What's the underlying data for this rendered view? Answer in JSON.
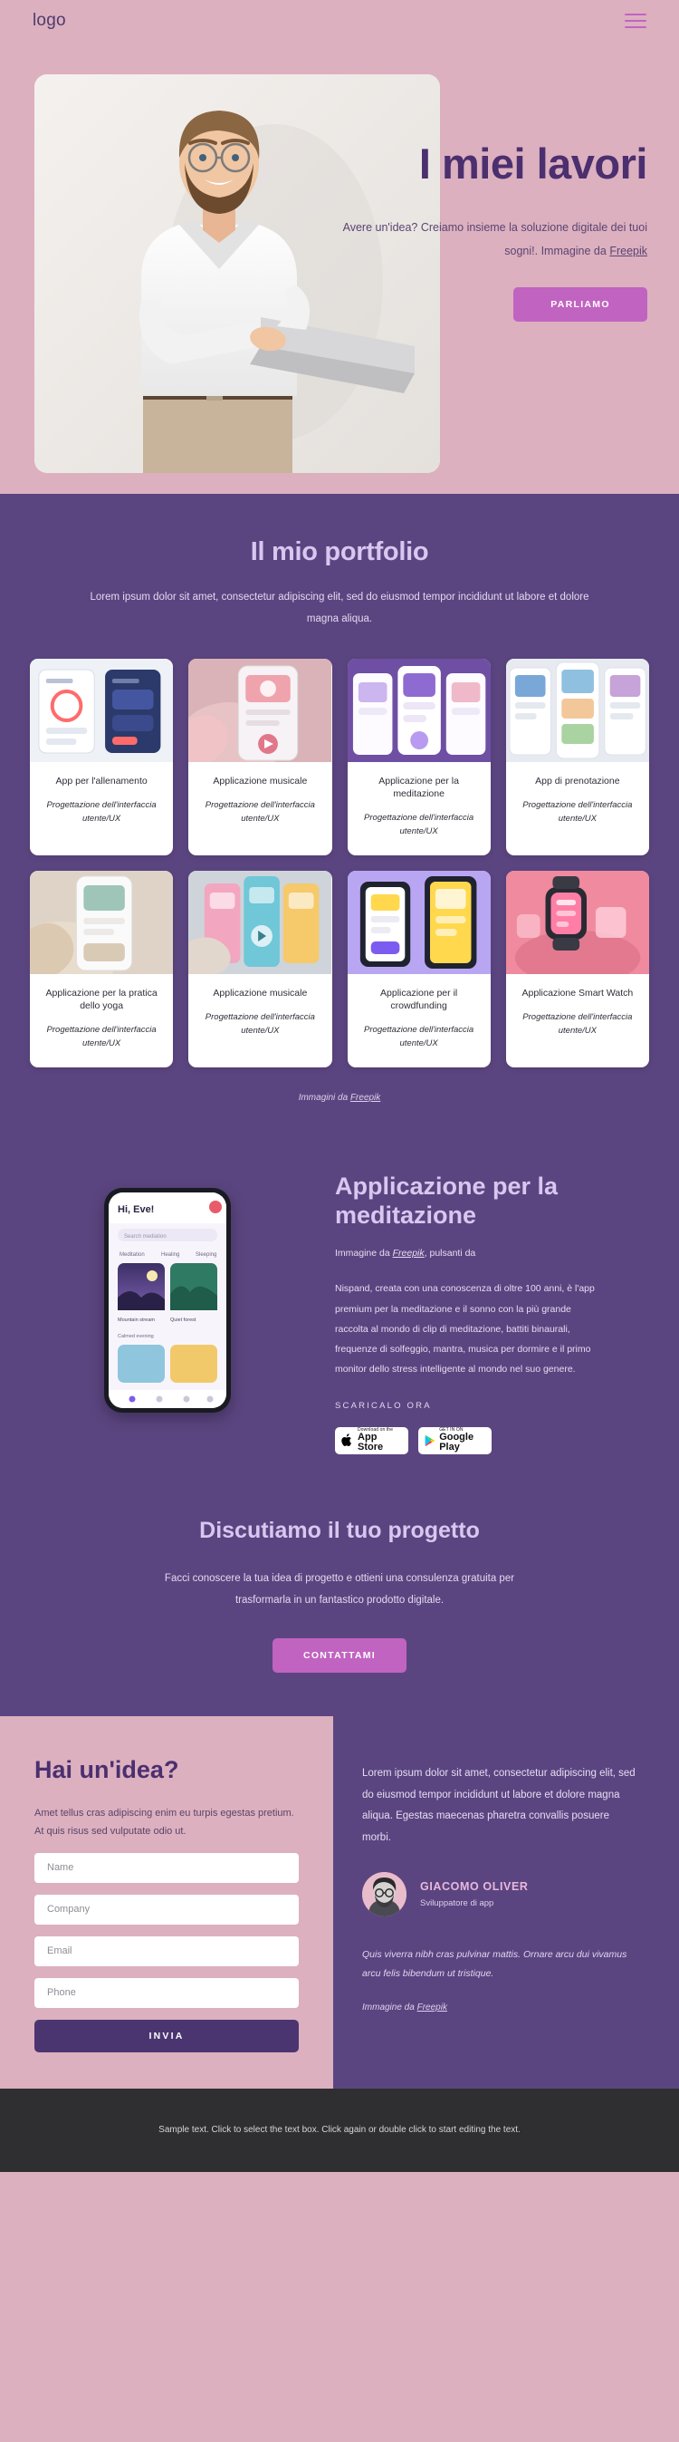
{
  "header": {
    "logo": "logo",
    "menu_icon": "hamburger-icon"
  },
  "hero": {
    "title": "I miei lavori",
    "subtitle_before": "Avere un'idea? Creiamo insieme la soluzione digitale dei tuoi sogni!. Immagine da ",
    "subtitle_link": "Freepik",
    "cta": "PARLIAMO"
  },
  "portfolio": {
    "title": "Il mio portfolio",
    "subtitle": "Lorem ipsum dolor sit amet, consectetur adipiscing elit, sed do eiusmod tempor incididunt ut labore et dolore magna aliqua.",
    "meta_default": "Progettazione dell'interfaccia utente/UX",
    "cards": [
      {
        "title": "App per l'allenamento",
        "meta": "Progettazione dell'interfaccia utente/UX"
      },
      {
        "title": "Applicazione musicale",
        "meta": "Progettazione dell'interfaccia utente/UX"
      },
      {
        "title": "Applicazione per la meditazione",
        "meta": "Progettazione dell'interfaccia utente/UX"
      },
      {
        "title": "App di prenotazione",
        "meta": "Progettazione dell'interfaccia utente/UX"
      },
      {
        "title": "Applicazione per la pratica dello yoga",
        "meta": "Progettazione dell'interfaccia utente/UX"
      },
      {
        "title": "Applicazione musicale",
        "meta": "Progettazione dell'interfaccia utente/UX"
      },
      {
        "title": "Applicazione per il crowdfunding",
        "meta": "Progettazione dell'interfaccia utente/UX"
      },
      {
        "title": "Applicazione Smart Watch",
        "meta": "Progettazione dell'interfaccia utente/UX"
      }
    ],
    "credit_before": "Immagini da ",
    "credit_link": "Freepik"
  },
  "meditation": {
    "title": "Applicazione per la meditazione",
    "credit_before": "Immagine da ",
    "credit_link": "Freepik",
    "credit_after": ", pulsanti da",
    "body": "Nispand, creata con una conoscenza di oltre 100 anni, è l'app premium per la meditazione e il sonno con la più grande raccolta al mondo di clip di meditazione, battiti binaurali, frequenze di solfeggio, mantra, musica per dormire e il primo monitor dello stress intelligente al mondo nel suo genere.",
    "download_label": "SCARICALO ORA",
    "badges": [
      {
        "icon": "apple-icon",
        "small": "Download on the",
        "big": "App Store"
      },
      {
        "icon": "google-play-icon",
        "small": "GET IN ON",
        "big": "Google Play"
      }
    ]
  },
  "discuss": {
    "title": "Discutiamo il tuo progetto",
    "subtitle": "Facci conoscere la tua idea di progetto e ottieni una consulenza gratuita per trasformarla in un fantastico prodotto digitale.",
    "cta": "CONTATTAMI"
  },
  "contact": {
    "title": "Hai un'idea?",
    "subtitle": "Amet tellus cras adipiscing enim eu turpis egestas pretium. At quis risus sed vulputate odio ut.",
    "fields": [
      {
        "name": "name",
        "placeholder": "Name",
        "value": ""
      },
      {
        "name": "company",
        "placeholder": "Company",
        "value": ""
      },
      {
        "name": "email",
        "placeholder": "Email",
        "value": ""
      },
      {
        "name": "phone",
        "placeholder": "Phone",
        "value": ""
      }
    ],
    "submit": "INVIA"
  },
  "testimonial": {
    "body": "Lorem ipsum dolor sit amet, consectetur adipiscing elit, sed do eiusmod tempor incididunt ut labore et dolore magna aliqua. Egestas maecenas pharetra convallis posuere morbi.",
    "name": "GIACOMO OLIVER",
    "role": "Sviluppatore di app",
    "quote": "Quis viverra nibh cras pulvinar mattis. Ornare arcu dui vivamus arcu felis bibendum ut tristique.",
    "credit_before": "Immagine da ",
    "credit_link": "Freepik"
  },
  "footer": {
    "text": "Sample text. Click to select the text box. Click again or double click to start editing the text."
  },
  "colors": {
    "pink_bg": "#dcb0bf",
    "purple_bg": "#5b4580",
    "deep_purple": "#4b2f6f",
    "accent_pink": "#c163c1",
    "lavender": "#d9c7f0",
    "footer_bg": "#2f2f31"
  }
}
